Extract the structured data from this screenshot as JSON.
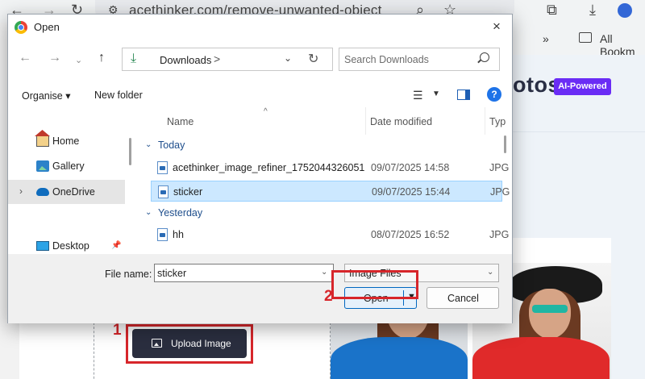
{
  "browser": {
    "url": "acethinker.com/remove-unwanted-object",
    "bookmarks_label": "All Bookm",
    "icons": [
      "back-icon",
      "forward-icon",
      "reload-icon",
      "site-info-icon",
      "zoom-icon",
      "star-icon",
      "extensions-icon",
      "download-icon",
      "profile-icon"
    ]
  },
  "site": {
    "brand_fragment": "otos",
    "ai_badge": "AI-Powered",
    "upload_button": "Upload Image",
    "annotation_1": "1",
    "annotation_2": "2",
    "accent_color": "#6a2cf5",
    "marker_color": "#d7262b"
  },
  "dialog": {
    "title": "Open",
    "close_icon": "×",
    "path": {
      "current_folder": "Downloads",
      "separator": ">"
    },
    "search": {
      "placeholder": "Search Downloads"
    },
    "command_bar": {
      "organise": "Organise ▾",
      "new_folder": "New folder"
    },
    "nav_pane": {
      "items": [
        {
          "label": "Home",
          "icon": "home-icon"
        },
        {
          "label": "Gallery",
          "icon": "gallery-icon"
        },
        {
          "label": "OneDrive",
          "icon": "cloud-icon",
          "selected": true
        },
        {
          "label": "Desktop",
          "icon": "desktop-icon",
          "pinned": true
        }
      ]
    },
    "columns": {
      "name": "Name",
      "date_modified": "Date modified",
      "type": "Typ"
    },
    "groups": [
      {
        "label": "Today",
        "files": [
          {
            "name": "acethinker_image_refiner_1752044326051",
            "date": "09/07/2025 14:58",
            "type": "JPG"
          },
          {
            "name": "sticker",
            "date": "09/07/2025 15:44",
            "type": "JPG",
            "selected": true
          }
        ]
      },
      {
        "label": "Yesterday",
        "files": [
          {
            "name": "hh",
            "date": "08/07/2025 16:52",
            "type": "JPG"
          }
        ]
      }
    ],
    "file_name_label": "File name:",
    "file_name_value": "sticker",
    "file_type": "Image Files",
    "open_button": "Open",
    "cancel_button": "Cancel"
  }
}
